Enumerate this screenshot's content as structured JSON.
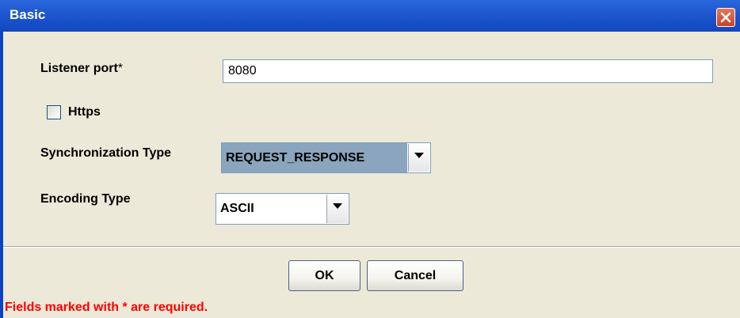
{
  "window": {
    "title": "Basic"
  },
  "form": {
    "listener_port_label": "Listener port",
    "required_marker": "*",
    "listener_port_value": "8080",
    "https_label": "Https",
    "https_checked": false,
    "sync_type_label": "Synchronization Type",
    "sync_type_value": "REQUEST_RESPONSE",
    "encoding_type_label": "Encoding Type",
    "encoding_type_value": "ASCII"
  },
  "buttons": {
    "ok": "OK",
    "cancel": "Cancel"
  },
  "footer": {
    "required_note": "Fields marked with * are required."
  },
  "colors": {
    "titlebar": "#1f58d0",
    "dialog_bg": "#ece9d8",
    "required_text": "#ff0000",
    "selected_combo": "#8aa5bd"
  },
  "icons": {
    "close": "close-icon",
    "dropdown": "chevron-down-icon"
  }
}
